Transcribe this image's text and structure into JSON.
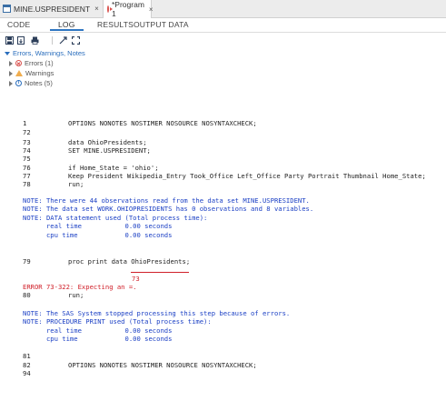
{
  "file_tabs": [
    {
      "label": "MINE.USPRESIDENT",
      "close": "×"
    },
    {
      "label": "*Program 1",
      "close": "×"
    }
  ],
  "sub_tabs": [
    "CODE",
    "LOG",
    "RESULTS",
    "OUTPUT DATA"
  ],
  "active_sub_tab": "LOG",
  "tree": {
    "header": "Errors, Warnings, Notes",
    "items": [
      {
        "label": "Errors (1)",
        "icon": "error-icon"
      },
      {
        "label": "Warnings",
        "icon": "warning-icon"
      },
      {
        "label": "Notes (5)",
        "icon": "note-icon"
      }
    ]
  },
  "log_lines": [
    {
      "num": "1",
      "text": "OPTIONS NONOTES NOSTIMER NOSOURCE NOSYNTAXCHECK;",
      "type": "code"
    },
    {
      "num": "72",
      "text": "",
      "type": "code"
    },
    {
      "num": "73",
      "text": "data OhioPresidents;",
      "type": "code"
    },
    {
      "num": "74",
      "text": "SET MINE.USPRESIDENT;",
      "type": "code"
    },
    {
      "num": "75",
      "text": "",
      "type": "code"
    },
    {
      "num": "76",
      "text": "if Home_State = 'ohio';",
      "type": "code"
    },
    {
      "num": "77",
      "text": "Keep President Wikipedia_Entry Took_Office Left_Office Party Portrait Thumbnail Home_State;",
      "type": "code"
    },
    {
      "num": "78",
      "text": "run;",
      "type": "code"
    },
    {
      "num": "",
      "text": "NOTE: There were 44 observations read from the data set MINE.USPRESIDENT.",
      "type": "note"
    },
    {
      "num": "",
      "text": "NOTE: The data set WORK.OHIOPRESIDENTS has 0 observations and 8 variables.",
      "type": "note"
    },
    {
      "num": "",
      "text": "NOTE: DATA statement used (Total process time):",
      "type": "note"
    },
    {
      "num": "",
      "text": "      real time           0.00 seconds",
      "type": "note"
    },
    {
      "num": "",
      "text": "      cpu time            0.00 seconds",
      "type": "note"
    },
    {
      "num": "79",
      "text": "proc print data OhioPresidents;",
      "type": "code"
    },
    {
      "num": "",
      "text": "ERROR 73-322: Expecting an =.",
      "type": "error"
    },
    {
      "num": "80",
      "text": "run;",
      "type": "code"
    },
    {
      "num": "",
      "text": "NOTE: The SAS System stopped processing this step because of errors.",
      "type": "note"
    },
    {
      "num": "",
      "text": "NOTE: PROCEDURE PRINT used (Total process time):",
      "type": "note"
    },
    {
      "num": "",
      "text": "      real time           0.00 seconds",
      "type": "note"
    },
    {
      "num": "",
      "text": "      cpu time            0.00 seconds",
      "type": "note"
    },
    {
      "num": "81",
      "text": "",
      "type": "code"
    },
    {
      "num": "82",
      "text": "OPTIONS NONOTES NOSTIMER NOSOURCE NOSYNTAXCHECK;",
      "type": "code"
    },
    {
      "num": "94",
      "text": "",
      "type": "code"
    }
  ],
  "error_marker": "73",
  "colors": {
    "note": "#1a3fc4",
    "error": "#d0202a",
    "accent": "#2f76c2"
  }
}
